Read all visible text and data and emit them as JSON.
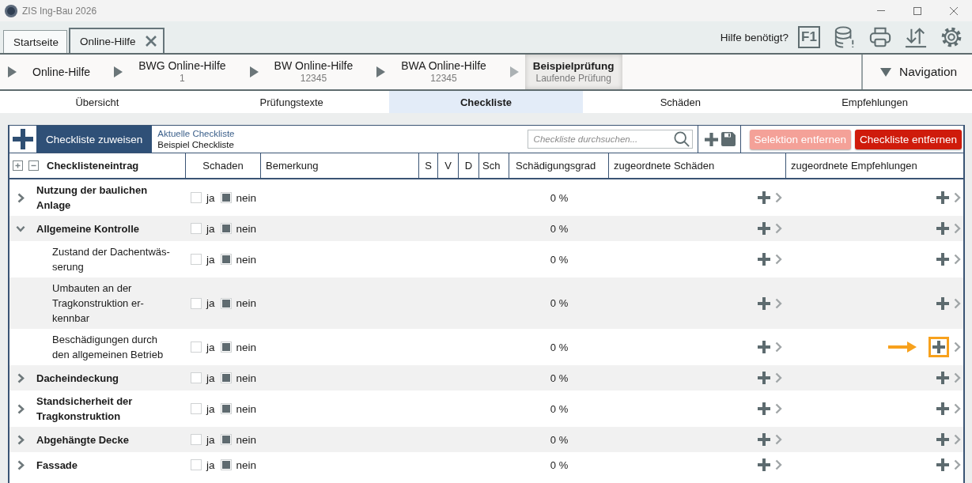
{
  "window": {
    "title": "ZIS Ing-Bau 2026"
  },
  "tabs": [
    {
      "label": "Startseite",
      "selected": false,
      "closable": false
    },
    {
      "label": "Online-Hilfe",
      "selected": true,
      "closable": true
    }
  ],
  "help": {
    "label": "Hilfe benötigt?"
  },
  "toolbar": [
    {
      "kind": "key",
      "label": "F1"
    },
    {
      "kind": "database"
    },
    {
      "kind": "print"
    },
    {
      "kind": "transfer"
    },
    {
      "kind": "settings"
    }
  ],
  "breadcrumbs": [
    {
      "label": "Online-Hilfe",
      "selected": false
    },
    {
      "label": "BWG Online-Hilfe",
      "sublabel": "1",
      "selected": false
    },
    {
      "label": "BW Online-Hilfe",
      "sublabel": "12345",
      "selected": false
    },
    {
      "label": "BWA Online-Hilfe",
      "sublabel": "12345",
      "selected": false
    },
    {
      "label": "Beispielprüfung",
      "sublabel": "Laufende Prüfung",
      "selected": true
    }
  ],
  "navigation": {
    "label": "Navigation"
  },
  "sections": [
    {
      "label": "Übersicht",
      "selected": false
    },
    {
      "label": "Prüfungstexte",
      "selected": false
    },
    {
      "label": "Checkliste",
      "selected": true
    },
    {
      "label": "Schäden",
      "selected": false
    },
    {
      "label": "Empfehlungen",
      "selected": false
    }
  ],
  "checklist": {
    "assign_button": "Checkliste zuweisen",
    "current_label": "Aktuelle Checkliste",
    "current_value": "Beispiel Checkliste",
    "search": {
      "placeholder": "Checkliste durchsuchen..."
    },
    "buttons": [
      {
        "label": "Selektion entfernen",
        "disabled": true
      },
      {
        "label": "Checkliste entfernen",
        "disabled": false
      }
    ]
  },
  "table": {
    "columns": [
      "Checklisteneintrag",
      "Schaden",
      "Bemerkung",
      "S",
      "V",
      "D",
      "Sch",
      "Schädigungsgrad",
      "zugeordnete Schäden",
      "zugeordnete Empfehlungen"
    ],
    "rows": [
      {
        "label": "Nutzung der baulichen Anlage",
        "expanded": false,
        "options": [
          {
            "label": "ja",
            "checked": false
          },
          {
            "label": "nein",
            "checked": true
          }
        ],
        "degree": "0 %",
        "highlighted": false
      },
      {
        "label": "Allgemeine Kontrolle",
        "expanded": true,
        "options": [
          {
            "label": "ja",
            "checked": false
          },
          {
            "label": "nein",
            "checked": true
          }
        ],
        "degree": "0 %",
        "highlighted": false,
        "children": [
          {
            "label": "Zustand der Dachentwäs-serung",
            "options": [
              {
                "label": "ja",
                "checked": false
              },
              {
                "label": "nein",
                "checked": true
              }
            ],
            "degree": "0 %",
            "highlighted": false
          },
          {
            "label": "Umbauten an der Tragkonstruktion er-kennbar",
            "options": [
              {
                "label": "ja",
                "checked": false
              },
              {
                "label": "nein",
                "checked": true
              }
            ],
            "degree": "0 %",
            "highlighted": false
          },
          {
            "label": "Beschädigungen durch den allgemeinen Betrieb",
            "options": [
              {
                "label": "ja",
                "checked": false
              },
              {
                "label": "nein",
                "checked": true
              }
            ],
            "degree": "0 %",
            "highlighted": true
          }
        ]
      },
      {
        "label": "Dacheindeckung",
        "expanded": false,
        "options": [
          {
            "label": "ja",
            "checked": false
          },
          {
            "label": "nein",
            "checked": true
          }
        ],
        "degree": "0 %",
        "highlighted": false
      },
      {
        "label": "Standsicherheit der Tragkonstruktion",
        "expanded": false,
        "options": [
          {
            "label": "ja",
            "checked": false
          },
          {
            "label": "nein",
            "checked": true
          }
        ],
        "degree": "0 %",
        "highlighted": false
      },
      {
        "label": "Abgehängte Decke",
        "expanded": false,
        "options": [
          {
            "label": "ja",
            "checked": false
          },
          {
            "label": "nein",
            "checked": true
          }
        ],
        "degree": "0 %",
        "highlighted": false
      },
      {
        "label": "Fassade",
        "expanded": false,
        "options": [
          {
            "label": "ja",
            "checked": false
          },
          {
            "label": "nein",
            "checked": true
          }
        ],
        "degree": "0 %",
        "highlighted": false
      }
    ]
  }
}
